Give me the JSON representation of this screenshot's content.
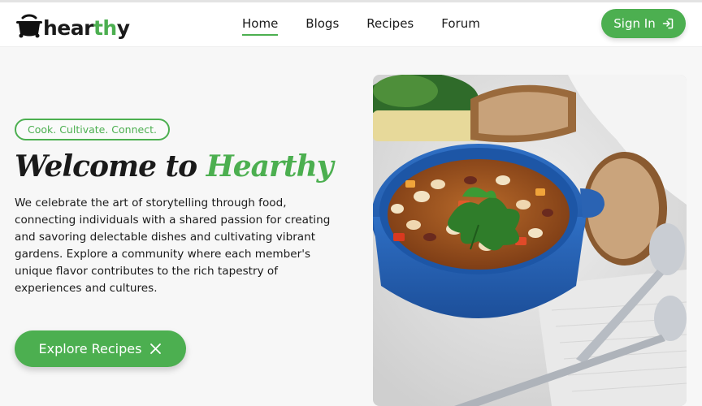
{
  "brand": {
    "name_prefix": "hear",
    "name_accent": "th",
    "name_suffix": "y",
    "color": "#4caf50"
  },
  "nav": {
    "items": [
      {
        "label": "Home",
        "active": true
      },
      {
        "label": "Blogs",
        "active": false
      },
      {
        "label": "Recipes",
        "active": false
      },
      {
        "label": "Forum",
        "active": false
      }
    ]
  },
  "header": {
    "signin_label": "Sign In",
    "signin_icon": "login-icon"
  },
  "hero": {
    "tagline": "Cook. Cultivate. Connect.",
    "title_prefix": "Welcome to",
    "title_brand": "Hearthy",
    "description": "We celebrate the art of storytelling through food, connecting individuals with a shared passion for creating and savoring delectable dishes and cultivating vibrant gardens. Explore a community where each member's unique flavor contributes to the rich tapestry of experiences and cultures.",
    "cta_label": "Explore Recipes",
    "cta_icon": "close-x-icon",
    "image_icon": "soup-bowl-photo"
  }
}
